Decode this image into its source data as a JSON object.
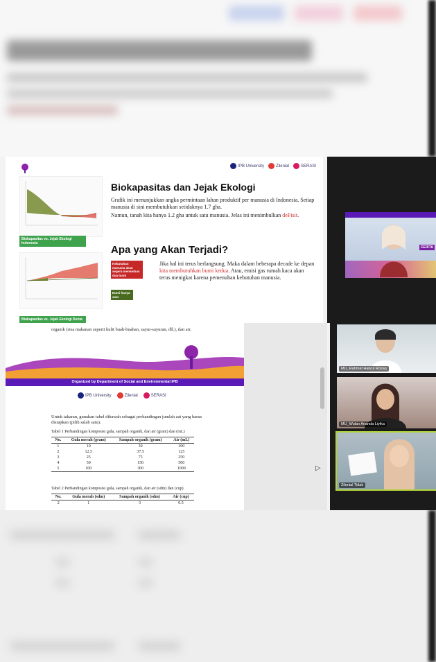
{
  "slide": {
    "title": "Biokapasitas dan Jejak Ekologi",
    "para1": "Grafik ini menunjukkan angka permintaan lahan produktif per manusia di Indonesia. Setiap manusia di sini membutuhkan setidaknya 1.7 gha.",
    "para2_a": "Namun, tanah kita hanya 1.2 gha untuk satu manusia. Jelas ini menimbulkan ",
    "para2_red": "deFisit",
    "para2_b": ".",
    "heading2": "Apa yang Akan Terjadi?",
    "para3_a": "Jika hal ini terus berlangsung. Maka dalam beberapa decade ke depan ",
    "para3_red": "kita membutuhkan bumi kedua",
    "para3_b": ". Atau, emisi gas rumah kaca akan terus menigkat karena pemenuhan kebutuhan manusia.",
    "caption1": "Biokapasitas vs. Jejak Ekologi Indonesia",
    "caption2": "Biokapasitas vs. Jejak Ekologi Dunia",
    "callout_red": "Kebutuhan manusia akan segera menembus dua bumi",
    "callout_green": "Bumi hanya satu",
    "logos": [
      "IPB University",
      "Zilenial",
      "SERASI"
    ]
  },
  "participants": [
    {
      "name": "MU_Rahmat Hakrul Rozaq"
    },
    {
      "name": "MU_Wulan Ananda Liyika"
    },
    {
      "name": "Zilenial Tidak"
    }
  ],
  "doc": {
    "top_line": "organik (sisa makanan seperti kulit buah-buahan, sayur-sayuran, dll.), dan air.",
    "banner": "Organized by Department of Social and Environmental IPB",
    "instr": "Untuk takaran, gunakan tabel dibawah sebagai perbandingan jumlah zat yang harus disiapkan (pilih salah satu).",
    "table1_caption": "Tabel 1 Perbandingan komposisi gula, sampah organik, dan air (gram) dan (mL)",
    "table1_headers": [
      "No.",
      "Gula merah (gram)",
      "Sampah organik (gram)",
      "Air (mL)"
    ],
    "table1_rows": [
      [
        "1",
        "10",
        "30",
        "100"
      ],
      [
        "2",
        "12.5",
        "37.5",
        "125"
      ],
      [
        "3",
        "25",
        "75",
        "250"
      ],
      [
        "4",
        "50",
        "150",
        "500"
      ],
      [
        "5",
        "100",
        "300",
        "1000"
      ]
    ],
    "table2_caption": "Tabel 2 Perbandingan komposisi gula, sampah organik, dan air (sdm) dan (cup)",
    "table2_headers": [
      "No.",
      "Gula merah (sdm)",
      "Sampah organik (sdm)",
      "Air (cup)"
    ],
    "table2_rows": [
      [
        "2",
        "1",
        "3",
        "0.5"
      ]
    ],
    "logos": [
      "IPB University",
      "Zilenial",
      "SERASI"
    ]
  },
  "colors": {
    "purple": "#5a1ab8",
    "green": "#3fa34d",
    "red": "#d32f2f",
    "dark_panel": "#1b1b1b"
  }
}
